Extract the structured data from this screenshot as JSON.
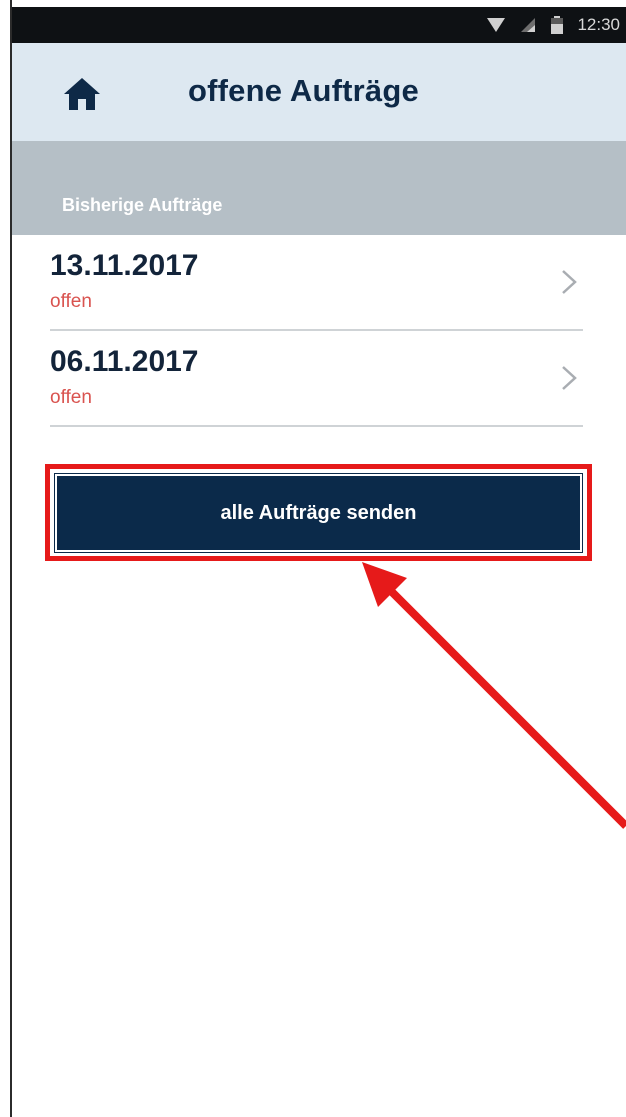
{
  "status_bar": {
    "time": "12:30"
  },
  "header": {
    "title": "offene Aufträge",
    "home_icon": "home-icon"
  },
  "section": {
    "label": "Bisherige Aufträge"
  },
  "orders": [
    {
      "date": "13.11.2017",
      "status": "offen"
    },
    {
      "date": "06.11.2017",
      "status": "offen"
    }
  ],
  "actions": {
    "send_all_label": "alle Aufträge senden"
  },
  "colors": {
    "header_bg": "#dde8f1",
    "primary": "#0b2a4a",
    "status_open": "#d9534f",
    "annotation": "#e61a1a"
  }
}
